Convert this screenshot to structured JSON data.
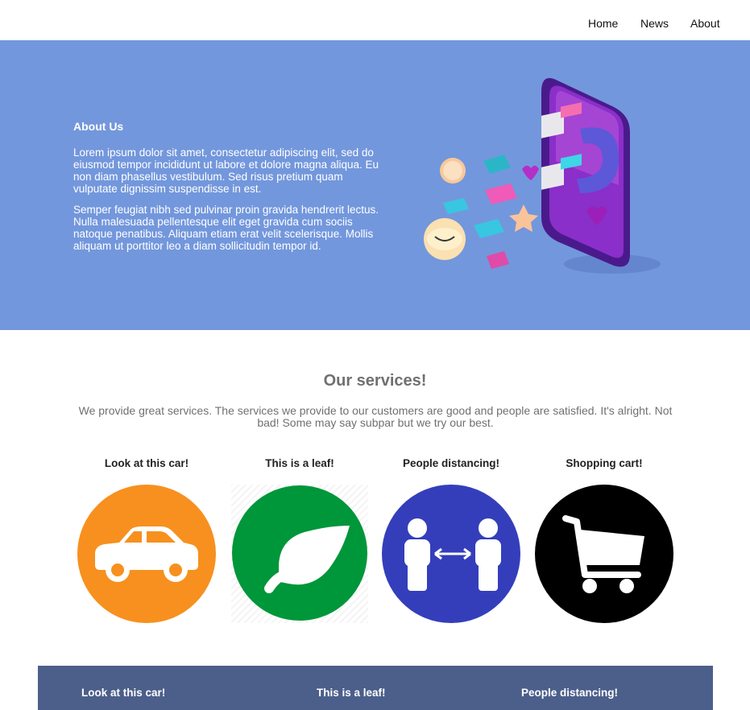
{
  "nav": {
    "items": [
      {
        "label": "Home"
      },
      {
        "label": "News"
      },
      {
        "label": "About"
      }
    ]
  },
  "hero": {
    "title": "About Us",
    "paragraphs": [
      "Lorem ipsum dolor sit amet, consectetur adipiscing elit, sed do eiusmod tempor incididunt ut labore et dolore magna aliqua. Eu non diam phasellus vestibulum. Sed risus pretium quam vulputate dignissim suspendisse in est.",
      "Semper feugiat nibh sed pulvinar proin gravida hendrerit lectus. Nulla malesuada pellentesque elit eget gravida cum sociis natoque penatibus. Aliquam etiam erat velit scelerisque. Mollis aliquam ut porttitor leo a diam sollicitudin tempor id."
    ],
    "illustration_icon": "phone-magnet-social-icon",
    "background_color": "#7397dc"
  },
  "services": {
    "title": "Our services!",
    "description": "We provide great services. The services we provide to our customers are good and people are satisfied. It's alright. Not bad! Some may say subpar but we try our best.",
    "items": [
      {
        "label": "Look at this car!",
        "icon": "car-icon",
        "color": "#f7901e"
      },
      {
        "label": "This is a leaf!",
        "icon": "leaf-icon",
        "color": "#00963a"
      },
      {
        "label": "People distancing!",
        "icon": "people-distancing-icon",
        "color": "#343ebb"
      },
      {
        "label": "Shopping cart!",
        "icon": "shopping-cart-icon",
        "color": "#000000"
      }
    ]
  },
  "footer": {
    "items": [
      {
        "label": "Look at this car!"
      },
      {
        "label": "This is a leaf!"
      },
      {
        "label": "People distancing!"
      }
    ],
    "background_color": "#4c5f8b"
  }
}
